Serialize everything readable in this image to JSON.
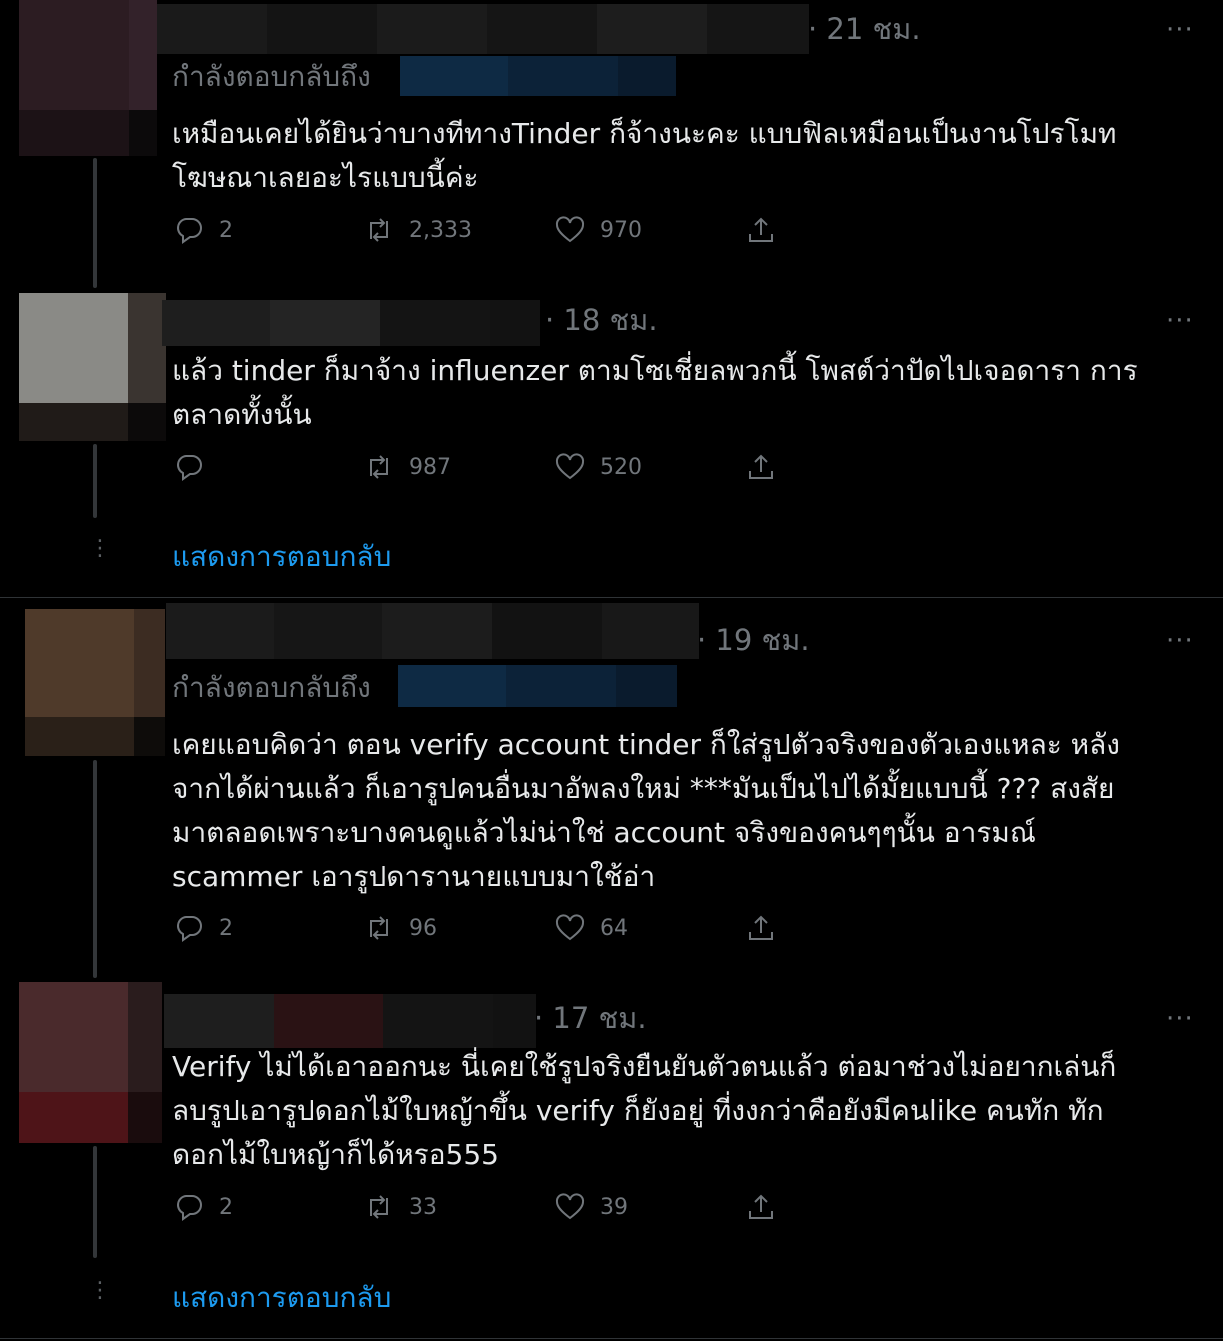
{
  "tweets": [
    {
      "time": "· 21 ชม.",
      "replying_to": "กำลังตอบกลับถึง",
      "text": "เหมือนเคยได้ยินว่าบางทีทางTinder ก็จ้างนะคะ แบบฟิลเหมือนเป็นงานโปรโมท\nโฆษณาเลยอะไรแบบนี้ค่ะ",
      "replies": "2",
      "retweets": "2,333",
      "likes": "970"
    },
    {
      "time": "· 18 ชม.",
      "text": "แล้ว tinder ก็มาจ้าง influenzer ตามโซเชี่ยลพวกนี้ โพสต์ว่าปัดไปเจอดารา  การ\nตลาดทั้งนั้น",
      "replies": "",
      "retweets": "987",
      "likes": "520"
    },
    {
      "time": "· 19 ชม.",
      "replying_to": "กำลังตอบกลับถึง",
      "text": "เคยแอบคิดว่า ตอน verify account tinder ก็ใส่รูปตัวจริงของตัวเองแหละ หลัง\nจากได้ผ่านแล้ว ก็เอารูปคนอื่นมาอัพลงใหม่ ***มันเป็นไปได้มั้ยแบบนี้ ??? สงสัย\nมาตลอดเพราะบางคนดูแล้วไม่น่าใช่ account จริงของคนๆๆนั้น อารมณ์\nscammer เอารูปดารานายแบบมาใช้อ่า",
      "replies": "2",
      "retweets": "96",
      "likes": "64"
    },
    {
      "time": "· 17 ชม.",
      "text": "Verify ไม่ได้เอาออกนะ นี่เคยใช้รูปจริงยืนยันตัวตนแล้ว ต่อมาช่วงไม่อยากเล่นก็\nลบรูปเอารูปดอกไม้ใบหญ้าขึ้น verify ก็ยังอยู่ ที่งงกว่าคือยังมีคนlike คนทัก ทัก\nดอกไม้ใบหญ้าก็ได้หรอ555",
      "replies": "2",
      "retweets": "33",
      "likes": "39"
    }
  ],
  "more_label": "···",
  "show_replies": "แสดงการตอบกลับ",
  "colors": {
    "accent": "#1d9bf0",
    "muted": "#71767b",
    "text": "#e7e9ea",
    "bg": "#000000"
  },
  "icons": [
    "reply-icon",
    "retweet-icon",
    "like-icon",
    "share-icon",
    "more-icon"
  ]
}
